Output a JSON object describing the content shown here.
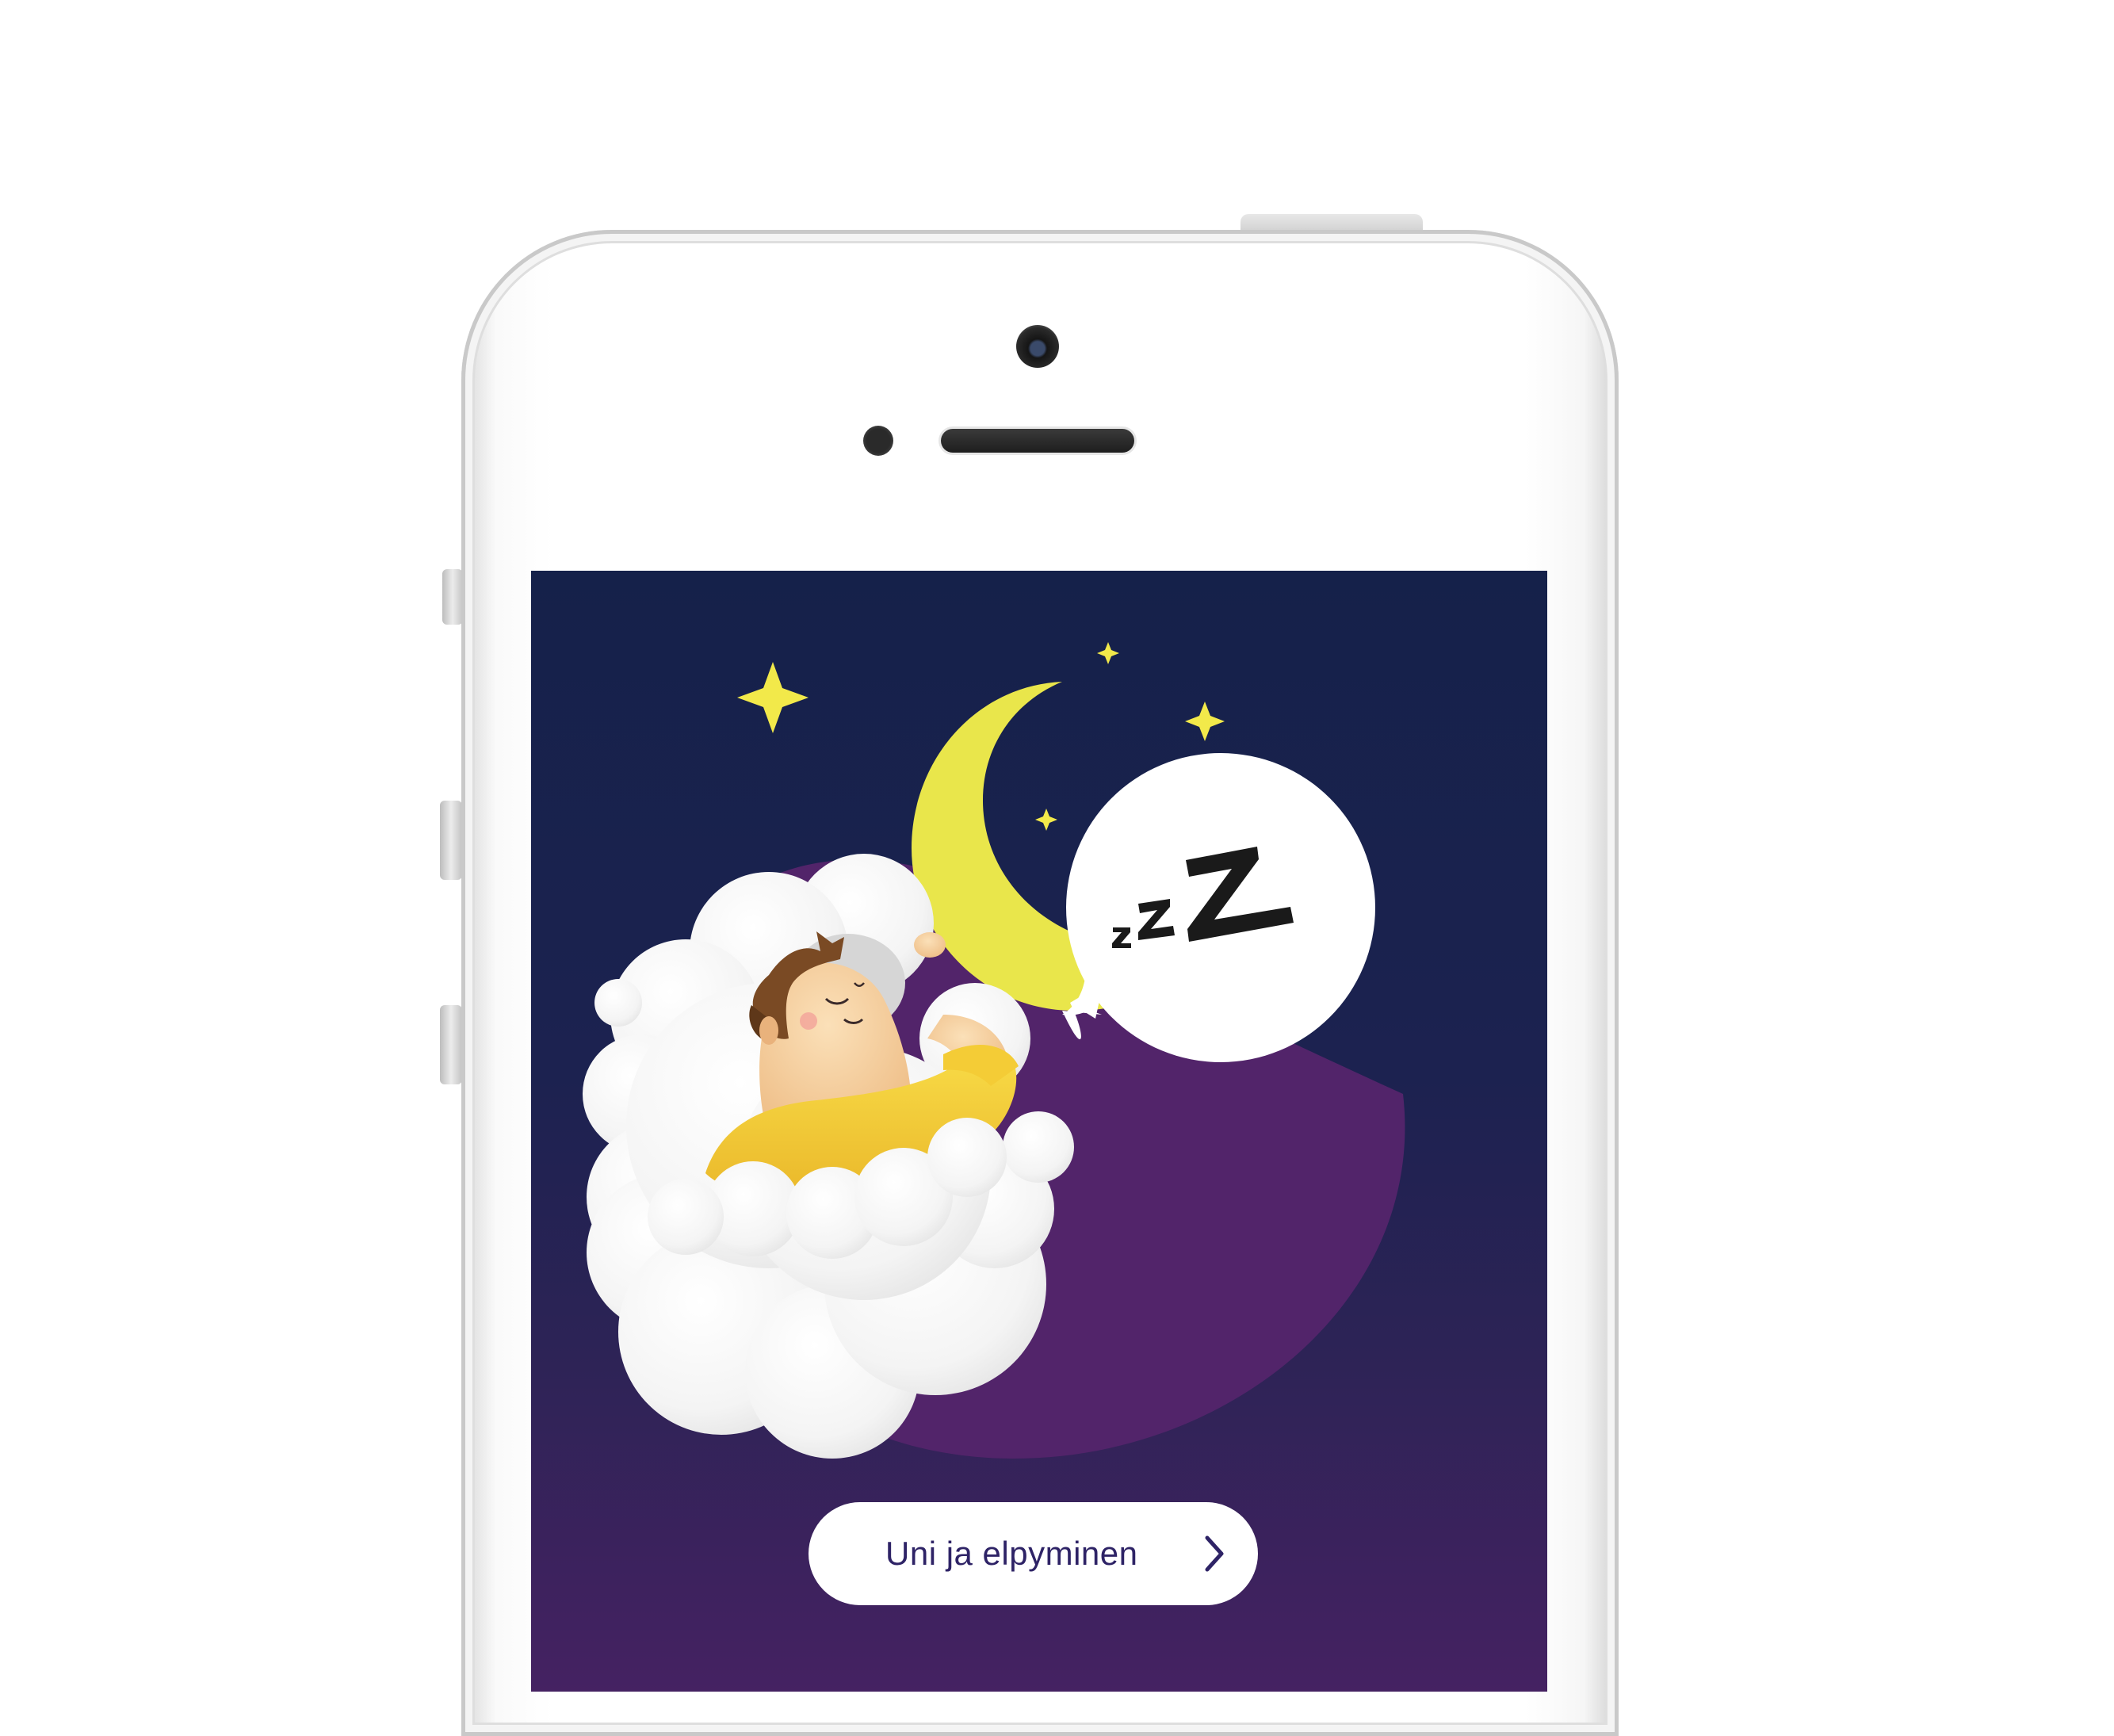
{
  "screen": {
    "illustration_icon": "sleeping-person-on-cloud-with-moon-icon",
    "speech_bubble_text": "zzZ",
    "cta_button": {
      "label": "Uni ja elpyminen",
      "icon": "chevron-right-icon"
    }
  },
  "colors": {
    "screen_top": "#15214a",
    "screen_bottom": "#452262",
    "moon": "#e9e64b",
    "star": "#f2e94a",
    "purple_backdrop": "#52246a",
    "shirt": "#f0c830",
    "button_text": "#2e2366"
  }
}
